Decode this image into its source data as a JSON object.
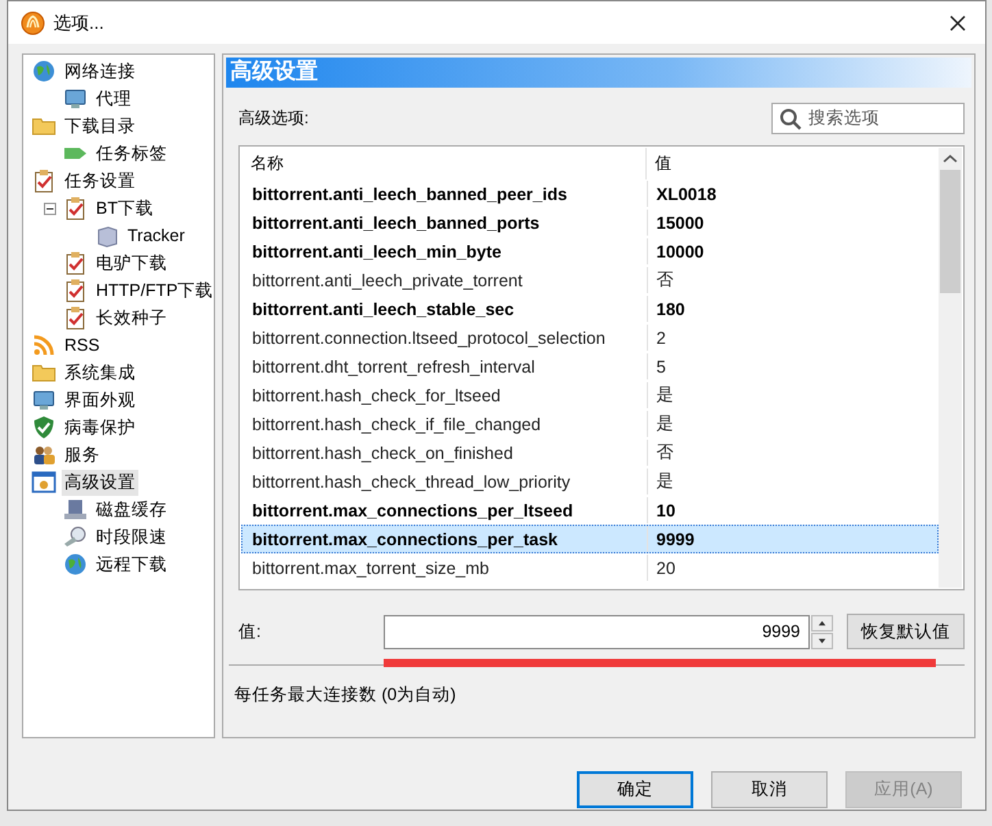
{
  "window": {
    "title": "选项..."
  },
  "tree": [
    {
      "label": "网络连接",
      "selected": false,
      "children": [
        {
          "label": "代理",
          "selected": false
        }
      ]
    },
    {
      "label": "下载目录",
      "selected": false,
      "children": [
        {
          "label": "任务标签",
          "selected": false
        }
      ]
    },
    {
      "label": "任务设置",
      "selected": false,
      "children": [
        {
          "label": "BT下载",
          "selected": false,
          "expanded": true,
          "children": [
            {
              "label": "Tracker",
              "selected": false
            }
          ]
        },
        {
          "label": "电驴下载",
          "selected": false
        },
        {
          "label": "HTTP/FTP下载",
          "selected": false
        },
        {
          "label": "长效种子",
          "selected": false
        }
      ]
    },
    {
      "label": "RSS",
      "selected": false
    },
    {
      "label": "系统集成",
      "selected": false
    },
    {
      "label": "界面外观",
      "selected": false
    },
    {
      "label": "病毒保护",
      "selected": false
    },
    {
      "label": "服务",
      "selected": false
    },
    {
      "label": "高级设置",
      "selected": true,
      "children": [
        {
          "label": "磁盘缓存",
          "selected": false
        },
        {
          "label": "时段限速",
          "selected": false
        },
        {
          "label": "远程下载",
          "selected": false
        }
      ]
    }
  ],
  "panel": {
    "title": "高级设置",
    "options_label": "高级选项:",
    "search": {
      "placeholder": "搜索选项"
    }
  },
  "table": {
    "columns": [
      "名称",
      "值"
    ],
    "rows": [
      {
        "name": "bittorrent.anti_leech_banned_peer_ids",
        "value": "XL0018",
        "modified": true,
        "selected": false
      },
      {
        "name": "bittorrent.anti_leech_banned_ports",
        "value": "15000",
        "modified": true,
        "selected": false
      },
      {
        "name": "bittorrent.anti_leech_min_byte",
        "value": "10000",
        "modified": true,
        "selected": false
      },
      {
        "name": "bittorrent.anti_leech_private_torrent",
        "value": "否",
        "modified": false,
        "selected": false
      },
      {
        "name": "bittorrent.anti_leech_stable_sec",
        "value": "180",
        "modified": true,
        "selected": false
      },
      {
        "name": "bittorrent.connection.ltseed_protocol_selection",
        "value": "2",
        "modified": false,
        "selected": false
      },
      {
        "name": "bittorrent.dht_torrent_refresh_interval",
        "value": "5",
        "modified": false,
        "selected": false
      },
      {
        "name": "bittorrent.hash_check_for_ltseed",
        "value": "是",
        "modified": false,
        "selected": false
      },
      {
        "name": "bittorrent.hash_check_if_file_changed",
        "value": "是",
        "modified": false,
        "selected": false
      },
      {
        "name": "bittorrent.hash_check_on_finished",
        "value": "否",
        "modified": false,
        "selected": false
      },
      {
        "name": "bittorrent.hash_check_thread_low_priority",
        "value": "是",
        "modified": false,
        "selected": false
      },
      {
        "name": "bittorrent.max_connections_per_ltseed",
        "value": "10",
        "modified": true,
        "selected": false
      },
      {
        "name": "bittorrent.max_connections_per_task",
        "value": "9999",
        "modified": true,
        "selected": true
      },
      {
        "name": "bittorrent.max_torrent_size_mb",
        "value": "20",
        "modified": false,
        "selected": false
      }
    ]
  },
  "value_label": "值:",
  "value": "9999",
  "reset_button": "恢复默认值",
  "description": "每任务最大连接数 (0为自动)",
  "buttons": [
    {
      "label": "确定",
      "kind": "default",
      "disabled": false
    },
    {
      "label": "取消",
      "kind": "normal",
      "disabled": false
    },
    {
      "label": "应用(A)",
      "kind": "normal",
      "disabled": true
    }
  ]
}
